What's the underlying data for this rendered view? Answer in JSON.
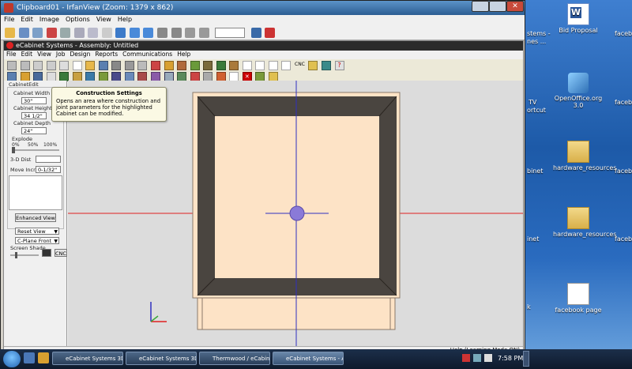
{
  "irfanview": {
    "title": "Clipboard01 - IrfanView (Zoom: 1379 x 862)",
    "menu": [
      "File",
      "Edit",
      "Image",
      "Options",
      "View",
      "Help"
    ]
  },
  "ecabinet": {
    "title": "eCabinet Systems - Assembly: Untitled",
    "menu": [
      "File",
      "Edit",
      "View",
      "Job",
      "Design",
      "Reports",
      "Communications",
      "Help"
    ],
    "cnc_label": "CNC",
    "panel": {
      "group_label": "CabinetEdit",
      "width_label": "Cabinet Width",
      "width_value": "30\"",
      "height_label": "Cabinet Height",
      "height_value": "34 1/2\"",
      "depth_label": "Cabinet Depth",
      "depth_value": "24\"",
      "explode_label": "Explode",
      "explode_ticks": [
        "0%",
        "50%",
        "100%"
      ],
      "dist_label": "3-D Dist",
      "move_label": "Move Incr.",
      "move_value": "0-1/32\"",
      "enhanced_label": "Enhanced View",
      "reset_view": "Reset View",
      "plane": "C-Plane Front",
      "shade_label": "Screen Shade",
      "cnc_button": "CNC"
    },
    "tooltip": {
      "title": "Construction Settings",
      "body": "Opens an area where construction and joint parameters for the highlighted Cabinet can be modified."
    },
    "status": "Help (Learning Mode ON)"
  },
  "desktop": {
    "icons": [
      {
        "label": "Bid Proposal"
      },
      {
        "label": "OpenOffice.org 3.0"
      },
      {
        "label": "hardware_resources"
      },
      {
        "label": "hardware_resources"
      },
      {
        "label": "facebook page"
      }
    ],
    "partial_labels": [
      "stems -",
      "nes ...",
      "TV",
      "ortcut",
      "binet",
      "inet",
      "k",
      "faceb",
      "faceb",
      "faceb",
      "faceb"
    ]
  },
  "taskbar": {
    "items": [
      "eCabinet Systems 3D ...",
      "eCabinet Systems 3D ...",
      "Thermwood / eCabin...",
      "eCabinet Systems - A..."
    ],
    "clock": "7:58 PM"
  },
  "colors": {
    "accent": "#2c5d92",
    "cabinet_frame": "#4a4540",
    "cabinet_face": "#fde3c6",
    "axis_x": "#e02020",
    "axis_y": "#3030c0"
  }
}
